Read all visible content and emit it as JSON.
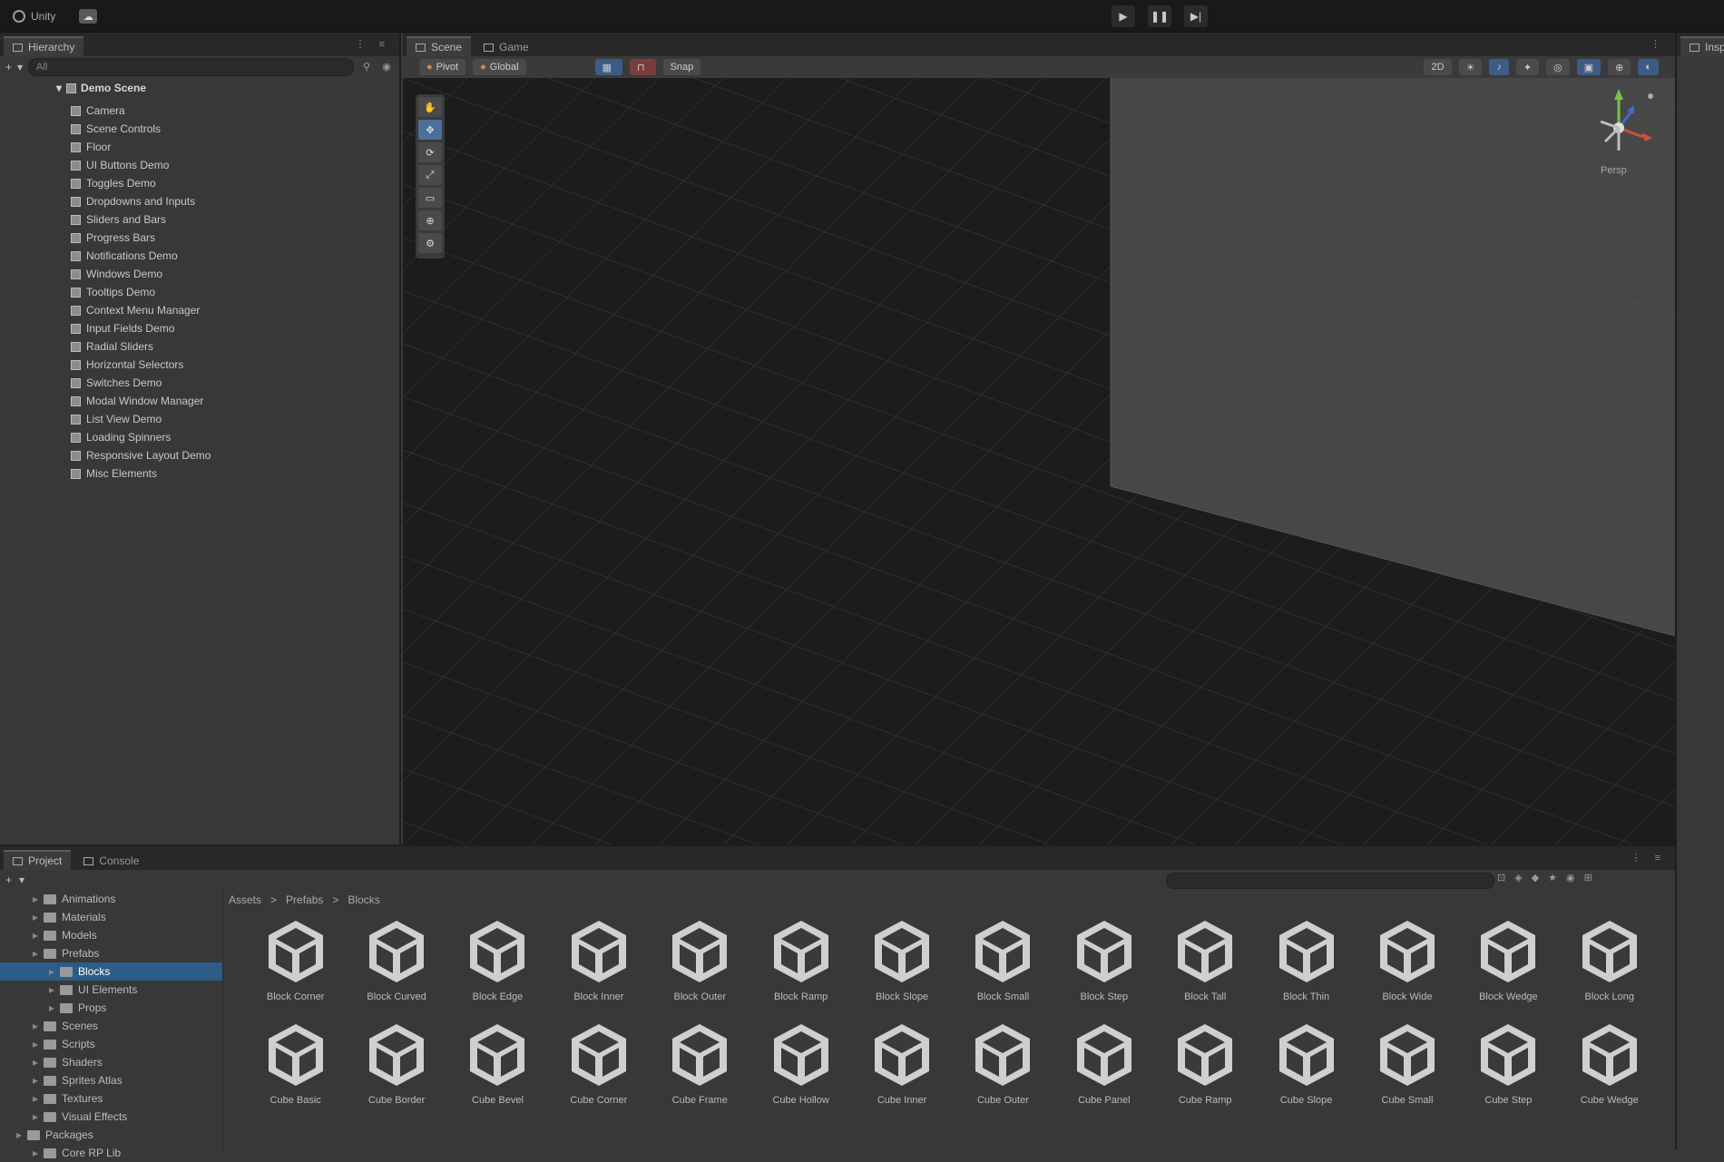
{
  "topbar": {
    "account_label": "Unity",
    "cloud_icon": "cloud-icon",
    "play": "▶",
    "pause": "❚❚",
    "step": "▶|"
  },
  "hierarchy": {
    "tab_label": "Hierarchy",
    "add_label": "+",
    "search_placeholder": "All",
    "scene_name": "Demo Scene",
    "items": [
      "Camera",
      "Scene Controls",
      "Floor",
      "UI Buttons Demo",
      "Toggles Demo",
      "Dropdowns and Inputs",
      "Sliders and Bars",
      "Progress Bars",
      "Notifications Demo",
      "Windows Demo",
      "Tooltips Demo",
      "Context Menu Manager",
      "Input Fields Demo",
      "Radial Sliders",
      "Horizontal Selectors",
      "Switches Demo",
      "Modal Window Manager",
      "List View Demo",
      "Loading Spinners",
      "Responsive Layout Demo",
      "Misc Elements"
    ]
  },
  "scene": {
    "tab_scene": "Scene",
    "tab_game": "Game",
    "toolbar_left": [
      "Pivot",
      "Global"
    ],
    "toolbar_mid": [
      "",
      "",
      "Snap"
    ],
    "toolbar_right": [
      "2D",
      "",
      "",
      "",
      "",
      "",
      ""
    ],
    "tools": [
      "✋",
      "✥",
      "⟳",
      "⤢",
      "▭",
      "⊕",
      "⚙"
    ],
    "persp_label": "Persp"
  },
  "inspector": {
    "tab_label": "Insp"
  },
  "project": {
    "tab_project": "Project",
    "tab_console": "Console",
    "add_label": "+",
    "tree": [
      {
        "label": "Animations",
        "indent": 2,
        "selected": false
      },
      {
        "label": "Materials",
        "indent": 2,
        "selected": false
      },
      {
        "label": "Models",
        "indent": 2,
        "selected": false
      },
      {
        "label": "Prefabs",
        "indent": 2,
        "selected": false
      },
      {
        "label": "Blocks",
        "indent": 3,
        "selected": true
      },
      {
        "label": "UI Elements",
        "indent": 3,
        "selected": false
      },
      {
        "label": "Props",
        "indent": 3,
        "selected": false
      },
      {
        "label": "Scenes",
        "indent": 2,
        "selected": false
      },
      {
        "label": "Scripts",
        "indent": 2,
        "selected": false
      },
      {
        "label": "Shaders",
        "indent": 2,
        "selected": false
      },
      {
        "label": "Sprites Atlas",
        "indent": 2,
        "selected": false
      },
      {
        "label": "Textures",
        "indent": 2,
        "selected": false
      },
      {
        "label": "Visual Effects",
        "indent": 2,
        "selected": false
      },
      {
        "label": "Packages",
        "indent": 1,
        "selected": false
      },
      {
        "label": "Core RP Lib",
        "indent": 2,
        "selected": false
      }
    ],
    "breadcrumb": [
      "Assets",
      ">",
      "Prefabs",
      ">",
      "Blocks"
    ],
    "assets": [
      "Block Corner",
      "Block Curved",
      "Block Edge",
      "Block Inner",
      "Block Outer",
      "Block Ramp",
      "Block Slope",
      "Block Small",
      "Block Step",
      "Block Tall",
      "Block Thin",
      "Block Wide",
      "Block Wedge",
      "Block Long",
      "Cube Basic",
      "Cube Border",
      "Cube Bevel",
      "Cube Corner",
      "Cube Frame",
      "Cube Hollow",
      "Cube Inner",
      "Cube Outer",
      "Cube Panel",
      "Cube Ramp",
      "Cube Slope",
      "Cube Small",
      "Cube Step",
      "Cube Wedge"
    ]
  }
}
